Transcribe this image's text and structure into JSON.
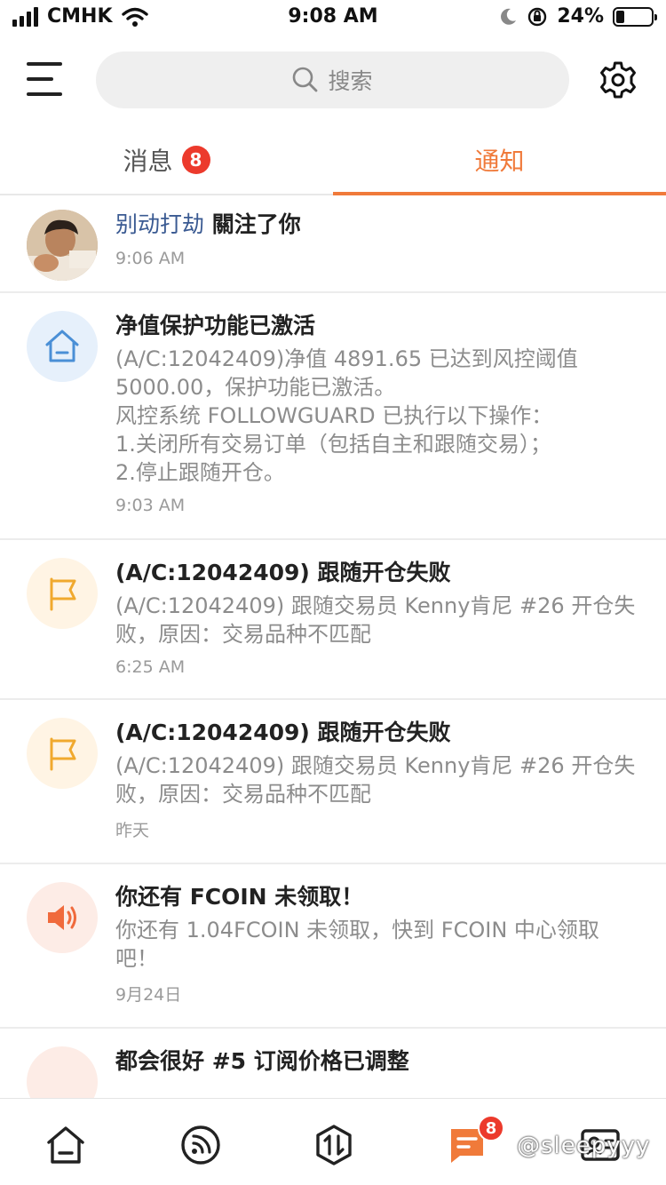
{
  "status_bar": {
    "carrier": "CMHK",
    "time": "9:08 AM",
    "battery_pct": "24%",
    "battery_level": 0.24,
    "icons": [
      "signal-icon",
      "wifi-icon",
      "moon-icon",
      "orientation-lock-icon",
      "battery-icon"
    ]
  },
  "header": {
    "search_placeholder": "搜索",
    "icons": [
      "menu-icon",
      "search-icon",
      "gear-icon"
    ]
  },
  "tabs": [
    {
      "label": "消息",
      "badge": "8",
      "active": false
    },
    {
      "label": "通知",
      "active": true
    }
  ],
  "colors": {
    "accent": "#f07a3a",
    "badge": "#ec3a2c",
    "name_link": "#3a5a92",
    "home_icon_bg": "#e6f0fb",
    "flag_icon_bg": "#fff4e4",
    "speaker_icon_bg": "#fdece6"
  },
  "notifications": [
    {
      "type": "follow",
      "icon": "avatar",
      "name": "别动打劫",
      "text": "關注了你",
      "time": "9:06 AM"
    },
    {
      "type": "system",
      "icon": "home-icon",
      "title": "净值保护功能已激活",
      "body": "(A/C:12042409)净值 4891.65 已达到风控阈值 5000.00，保护功能已激活。\n风控系统 FOLLOWGUARD 已执行以下操作：\n1.关闭所有交易订单（包括自主和跟随交易）；\n2.停止跟随开仓。",
      "time": "9:03 AM"
    },
    {
      "type": "trade",
      "icon": "flag-icon",
      "title": "(A/C:12042409) 跟随开仓失败",
      "body": "(A/C:12042409) 跟随交易员 Kenny肯尼 #26 开仓失败，原因：交易品种不匹配",
      "time": "6:25 AM"
    },
    {
      "type": "trade",
      "icon": "flag-icon",
      "title": "(A/C:12042409) 跟随开仓失败",
      "body": "(A/C:12042409) 跟随交易员 Kenny肯尼 #26 开仓失败，原因：交易品种不匹配",
      "time": "昨天"
    },
    {
      "type": "promo",
      "icon": "speaker-icon",
      "title": "你还有 FCOIN 未领取！",
      "body": "你还有 1.04FCOIN 未领取，快到 FCOIN 中心领取吧！",
      "time": "9月24日"
    },
    {
      "type": "partial",
      "icon": "speaker-icon",
      "title": "都会很好 #5 订阅价格已调整"
    }
  ],
  "bottom_nav": {
    "items": [
      "home-icon",
      "feed-icon",
      "trade-icon",
      "messages-icon",
      "profile-icon"
    ],
    "messages_badge": "8",
    "watermark": "@sleepyyy"
  }
}
